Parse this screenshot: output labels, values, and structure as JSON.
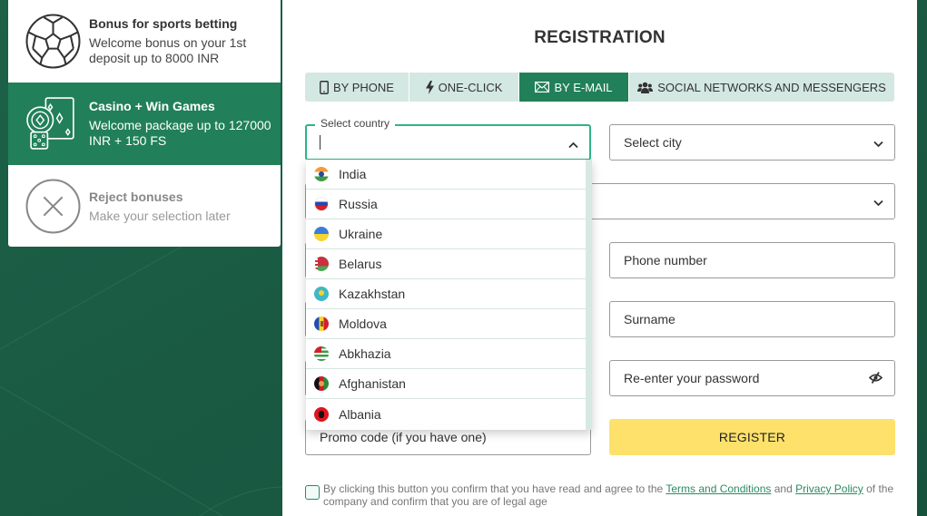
{
  "bonuses": [
    {
      "title": "Bonus for sports betting",
      "desc": "Welcome bonus on your 1st deposit up to 8000 INR",
      "icon": "soccer-ball-icon",
      "active": false
    },
    {
      "title": "Casino + Win Games",
      "desc": "Welcome package up to 127000 INR + 150 FS",
      "icon": "casino-chips-cards-dice-icon",
      "active": true
    },
    {
      "title": "Reject bonuses",
      "desc": "Make your selection later",
      "icon": "close-circle-icon",
      "active": false
    }
  ],
  "registration": {
    "title": "REGISTRATION",
    "tabs": [
      {
        "label": "BY PHONE",
        "icon": "phone-icon"
      },
      {
        "label": "ONE-CLICK",
        "icon": "lightning-icon"
      },
      {
        "label": "BY E-MAIL",
        "icon": "envelope-icon",
        "active": true
      },
      {
        "label": "SOCIAL NETWORKS AND MESSENGERS",
        "icon": "users-icon"
      }
    ],
    "country": {
      "legend": "Select country",
      "value": ""
    },
    "city": {
      "placeholder": "Select city"
    },
    "currency": {
      "value": ""
    },
    "phone": {
      "placeholder": "Phone number"
    },
    "surname": {
      "placeholder": "Surname"
    },
    "password_repeat": {
      "placeholder": "Re-enter your password"
    },
    "promo": {
      "placeholder": "Promo code (if you have one)"
    },
    "register_label": "REGISTER",
    "agree": {
      "prefix": "By clicking this button you confirm that you have read and agree to the ",
      "terms": "Terms and Conditions",
      "and": " and ",
      "privacy": "Privacy Policy",
      "suffix": " of the company and confirm that you are of legal age",
      "checked": false
    },
    "countries": [
      {
        "name": "India",
        "flag": "flag-india"
      },
      {
        "name": "Russia",
        "flag": "flag-russia"
      },
      {
        "name": "Ukraine",
        "flag": "flag-ukraine"
      },
      {
        "name": "Belarus",
        "flag": "flag-belarus"
      },
      {
        "name": "Kazakhstan",
        "flag": "flag-kazakhstan"
      },
      {
        "name": "Moldova",
        "flag": "flag-moldova"
      },
      {
        "name": "Abkhazia",
        "flag": "flag-abkhazia"
      },
      {
        "name": "Afghanistan",
        "flag": "flag-afghanistan"
      },
      {
        "name": "Albania",
        "flag": "flag-albania"
      }
    ]
  },
  "colors": {
    "brand_green": "#218059",
    "focus_green": "#2bb58a",
    "tab_bg": "#d3e8e2",
    "register_yellow": "#fde16b",
    "background_green": "#1a5a43"
  }
}
